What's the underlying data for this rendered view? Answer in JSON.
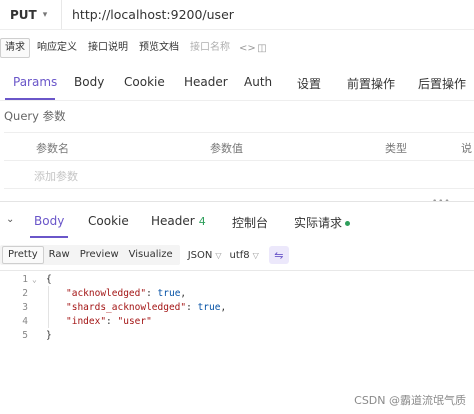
{
  "request": {
    "method": "PUT",
    "url": "http://localhost:9200/user"
  },
  "doc_tabs": [
    {
      "label": "请求"
    },
    {
      "label": "响应定义"
    },
    {
      "label": "接口说明"
    },
    {
      "label": "预览文档"
    },
    {
      "label": "接口名称"
    }
  ],
  "request_tabs": [
    "Params",
    "Body",
    "Cookie",
    "Header",
    "Auth",
    "设置",
    "前置操作",
    "后置操作"
  ],
  "query": {
    "section_label": "Query 参数",
    "columns": [
      "参数名",
      "参数值",
      "类型",
      "说"
    ],
    "add_placeholder": "添加参数"
  },
  "response_tabs": {
    "body": "Body",
    "cookie": "Cookie",
    "header": "Header",
    "header_count": "4",
    "console": "控制台",
    "actual_request": "实际请求"
  },
  "view_modes": [
    "Pretty",
    "Raw",
    "Preview",
    "Visualize"
  ],
  "format": "JSON",
  "encoding": "utf8",
  "code": {
    "line_numbers": [
      "1",
      "2",
      "3",
      "4",
      "5"
    ],
    "open_brace": "{",
    "close_brace": "}",
    "lines": [
      {
        "key": "\"acknowledged\"",
        "value": "true",
        "trail": ","
      },
      {
        "key": "\"shards_acknowledged\"",
        "value": "true",
        "trail": ","
      },
      {
        "key": "\"index\"",
        "value": "\"user\"",
        "trail": ""
      }
    ]
  },
  "watermark": "CSDN @霸道流氓气质",
  "colors": {
    "accent": "#6a56c9",
    "success": "#2e9e5b"
  }
}
